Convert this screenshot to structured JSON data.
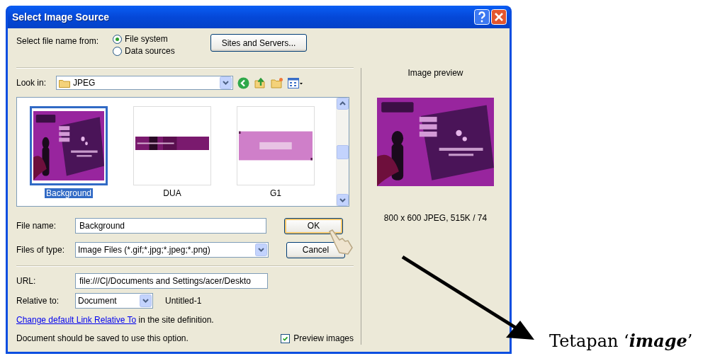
{
  "window": {
    "title": "Select Image Source"
  },
  "source": {
    "label": "Select file name from:",
    "options": [
      {
        "label": "File system",
        "selected": true
      },
      {
        "label": "Data sources",
        "selected": false
      }
    ],
    "button": "Sites and Servers..."
  },
  "look_in": {
    "label": "Look in:",
    "value": "JPEG"
  },
  "files": [
    {
      "name": "Background",
      "selected": true
    },
    {
      "name": "DUA",
      "selected": false
    },
    {
      "name": "G1",
      "selected": false
    }
  ],
  "file_name": {
    "label": "File name:",
    "value": "Background"
  },
  "file_type": {
    "label": "Files of type:",
    "value": "Image Files (*.gif;*.jpg;*.jpeg;*.png)"
  },
  "buttons": [
    {
      "label": "OK",
      "default": true
    },
    {
      "label": "Cancel",
      "default": false
    }
  ],
  "url": {
    "label": "URL:",
    "value": "file:///C|/Documents and Settings/acer/Deskto"
  },
  "relative_to": {
    "label": "Relative to:",
    "value": "Document",
    "document": "Untitled-1"
  },
  "site_note": {
    "link": "Change default Link Relative To",
    "text": "in the site definition."
  },
  "save_note": "Document should be saved to use this option.",
  "preview_images": {
    "label": "Preview images",
    "checked": true
  },
  "preview": {
    "title": "Image preview",
    "info": "800 x 600 JPEG, 515K / 74"
  },
  "annotation": {
    "text": "Tetapan ‘**image**’"
  }
}
